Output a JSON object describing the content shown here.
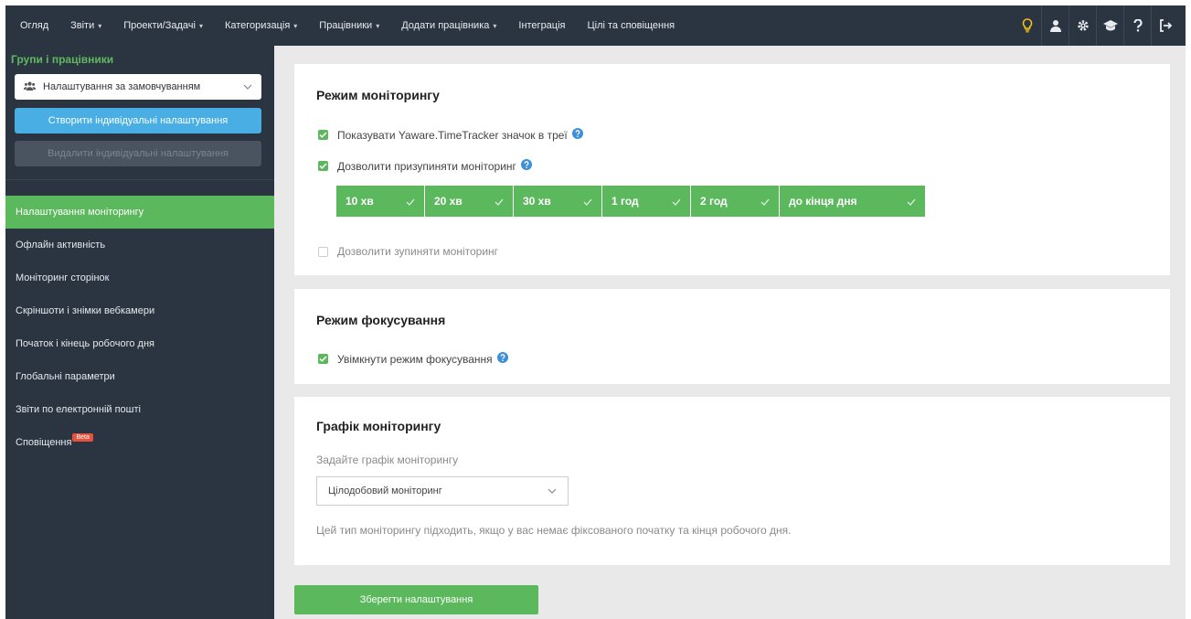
{
  "topnav": {
    "items": [
      {
        "label": "Огляд",
        "dropdown": false
      },
      {
        "label": "Звіти",
        "dropdown": true
      },
      {
        "label": "Проекти/Задачі",
        "dropdown": true
      },
      {
        "label": "Категоризація",
        "dropdown": true
      },
      {
        "label": "Працівники",
        "dropdown": true
      },
      {
        "label": "Додати працівника",
        "dropdown": true
      },
      {
        "label": "Інтеграція",
        "dropdown": false
      },
      {
        "label": "Цілі та сповіщення",
        "dropdown": false
      }
    ],
    "icons": [
      "lightbulb-icon",
      "user-icon",
      "gear-icon",
      "graduation-cap-icon",
      "question-icon",
      "logout-icon"
    ],
    "caret_glyph": "▾"
  },
  "sidebar": {
    "group_title": "Групи і працівники",
    "group_select_value": "Налаштування за замовчуванням",
    "create_button": "Створити індивідуальні налаштування",
    "delete_button": "Видалити індивідуальні налаштування",
    "menu": [
      {
        "label": "Налаштування моніторингу",
        "active": true
      },
      {
        "label": "Офлайн активність",
        "active": false
      },
      {
        "label": "Моніторинг сторінок",
        "active": false
      },
      {
        "label": "Скріншоти і знімки вебкамери",
        "active": false
      },
      {
        "label": "Початок і кінець робочого дня",
        "active": false
      },
      {
        "label": "Глобальні параметри",
        "active": false
      },
      {
        "label": "Звіти по електронній пошті",
        "active": false
      },
      {
        "label": "Сповіщення",
        "active": false
      }
    ],
    "beta_badge": "Beta"
  },
  "monitoring_mode": {
    "title": "Режим моніторингу",
    "show_tray_icon": {
      "label": "Показувати Yaware.TimeTracker значок в треї",
      "checked": true
    },
    "allow_pause": {
      "label": "Дозволити призупиняти моніторинг",
      "checked": true
    },
    "pause_options": [
      "10 хв",
      "20 хв",
      "30 хв",
      "1 год",
      "2 год",
      "до кінця дня"
    ],
    "allow_stop": {
      "label": "Дозволити зупиняти моніторинг",
      "checked": false
    }
  },
  "focus_mode": {
    "title": "Режим фокусування",
    "enable": {
      "label": "Увімкнути режим фокусування",
      "checked": true
    }
  },
  "schedule": {
    "title": "Графік моніторингу",
    "label": "Задайте графік моніторингу",
    "select_value": "Цілодобовий моніторинг",
    "description": "Цей тип моніторингу підходить, якщо у вас немає фіксованого початку та кінця робочого дня."
  },
  "save_button": "Зберегти налаштування",
  "colors": {
    "nav_bg": "#2b3441",
    "accent_green": "#5cb85c",
    "accent_blue": "#49aee3",
    "help_blue": "#3d8fd8",
    "beta_red": "#e5533d"
  }
}
